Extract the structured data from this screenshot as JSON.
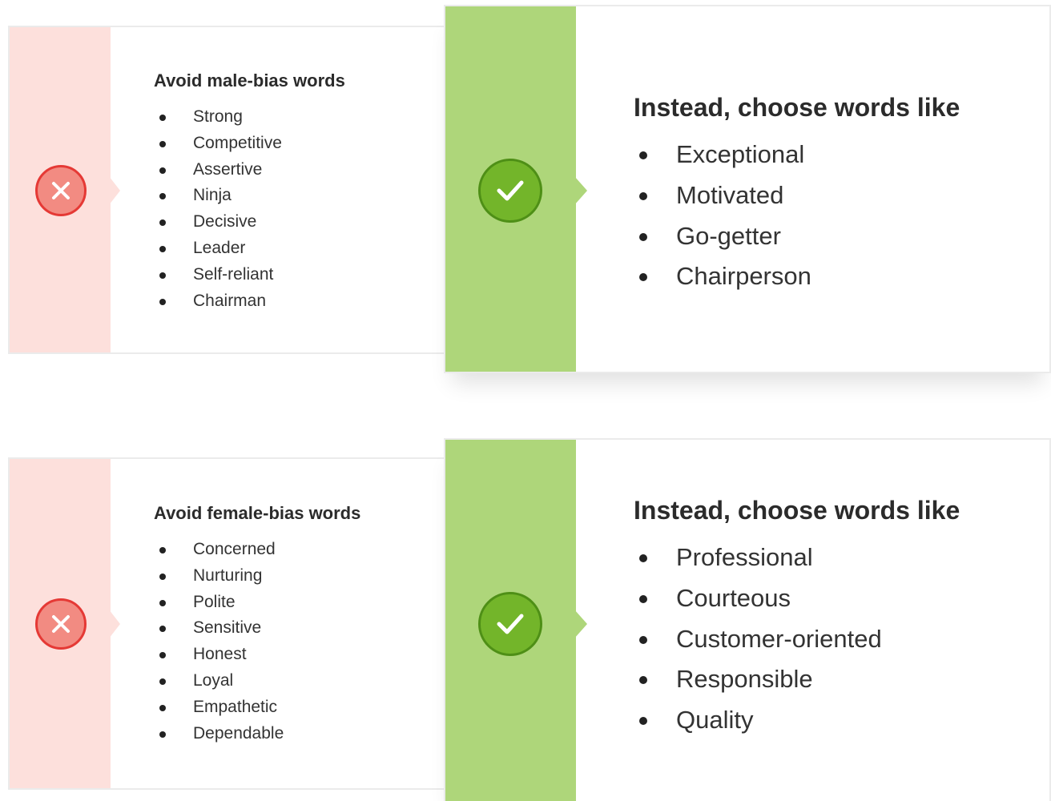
{
  "sections": [
    {
      "avoid": {
        "title": "Avoid male-bias words",
        "items": [
          "Strong",
          "Competitive",
          "Assertive",
          "Ninja",
          "Decisive",
          "Leader",
          "Self-reliant",
          "Chairman"
        ]
      },
      "choose": {
        "title": "Instead, choose words like",
        "items": [
          "Exceptional",
          "Motivated",
          "Go-getter",
          "Chairperson"
        ]
      }
    },
    {
      "avoid": {
        "title": "Avoid female-bias words",
        "items": [
          "Concerned",
          "Nurturing",
          "Polite",
          "Sensitive",
          "Honest",
          "Loyal",
          "Empathetic",
          "Dependable"
        ]
      },
      "choose": {
        "title": "Instead, choose words like",
        "items": [
          "Professional",
          "Courteous",
          "Customer-oriented",
          "Responsible",
          "Quality"
        ]
      }
    }
  ],
  "icons": {
    "avoid": "x-icon",
    "choose": "checkmark-icon"
  },
  "colors": {
    "avoid_stripe": "#fde0dc",
    "avoid_badge": "#f28b82",
    "choose_stripe": "#aed67a",
    "choose_badge": "#73b52a"
  }
}
